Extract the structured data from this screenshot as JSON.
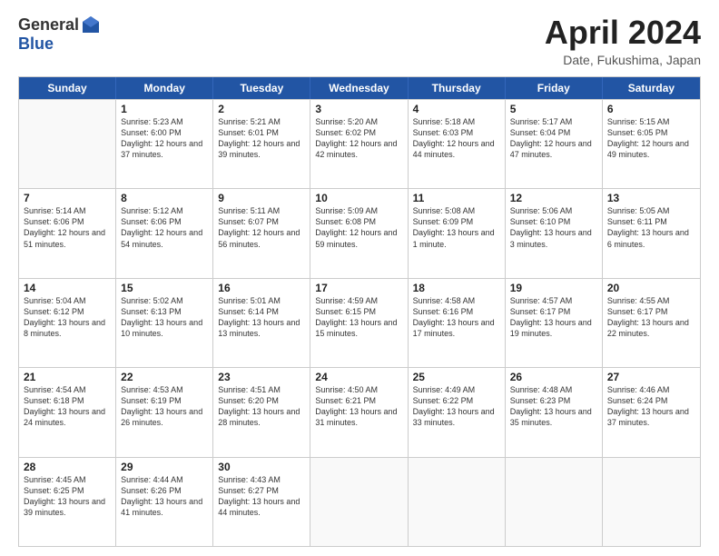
{
  "logo": {
    "general": "General",
    "blue": "Blue"
  },
  "header": {
    "month": "April 2024",
    "location": "Date, Fukushima, Japan"
  },
  "weekdays": [
    "Sunday",
    "Monday",
    "Tuesday",
    "Wednesday",
    "Thursday",
    "Friday",
    "Saturday"
  ],
  "weeks": [
    [
      {
        "day": "",
        "sunrise": "",
        "sunset": "",
        "daylight": ""
      },
      {
        "day": "1",
        "sunrise": "Sunrise: 5:23 AM",
        "sunset": "Sunset: 6:00 PM",
        "daylight": "Daylight: 12 hours and 37 minutes."
      },
      {
        "day": "2",
        "sunrise": "Sunrise: 5:21 AM",
        "sunset": "Sunset: 6:01 PM",
        "daylight": "Daylight: 12 hours and 39 minutes."
      },
      {
        "day": "3",
        "sunrise": "Sunrise: 5:20 AM",
        "sunset": "Sunset: 6:02 PM",
        "daylight": "Daylight: 12 hours and 42 minutes."
      },
      {
        "day": "4",
        "sunrise": "Sunrise: 5:18 AM",
        "sunset": "Sunset: 6:03 PM",
        "daylight": "Daylight: 12 hours and 44 minutes."
      },
      {
        "day": "5",
        "sunrise": "Sunrise: 5:17 AM",
        "sunset": "Sunset: 6:04 PM",
        "daylight": "Daylight: 12 hours and 47 minutes."
      },
      {
        "day": "6",
        "sunrise": "Sunrise: 5:15 AM",
        "sunset": "Sunset: 6:05 PM",
        "daylight": "Daylight: 12 hours and 49 minutes."
      }
    ],
    [
      {
        "day": "7",
        "sunrise": "Sunrise: 5:14 AM",
        "sunset": "Sunset: 6:06 PM",
        "daylight": "Daylight: 12 hours and 51 minutes."
      },
      {
        "day": "8",
        "sunrise": "Sunrise: 5:12 AM",
        "sunset": "Sunset: 6:06 PM",
        "daylight": "Daylight: 12 hours and 54 minutes."
      },
      {
        "day": "9",
        "sunrise": "Sunrise: 5:11 AM",
        "sunset": "Sunset: 6:07 PM",
        "daylight": "Daylight: 12 hours and 56 minutes."
      },
      {
        "day": "10",
        "sunrise": "Sunrise: 5:09 AM",
        "sunset": "Sunset: 6:08 PM",
        "daylight": "Daylight: 12 hours and 59 minutes."
      },
      {
        "day": "11",
        "sunrise": "Sunrise: 5:08 AM",
        "sunset": "Sunset: 6:09 PM",
        "daylight": "Daylight: 13 hours and 1 minute."
      },
      {
        "day": "12",
        "sunrise": "Sunrise: 5:06 AM",
        "sunset": "Sunset: 6:10 PM",
        "daylight": "Daylight: 13 hours and 3 minutes."
      },
      {
        "day": "13",
        "sunrise": "Sunrise: 5:05 AM",
        "sunset": "Sunset: 6:11 PM",
        "daylight": "Daylight: 13 hours and 6 minutes."
      }
    ],
    [
      {
        "day": "14",
        "sunrise": "Sunrise: 5:04 AM",
        "sunset": "Sunset: 6:12 PM",
        "daylight": "Daylight: 13 hours and 8 minutes."
      },
      {
        "day": "15",
        "sunrise": "Sunrise: 5:02 AM",
        "sunset": "Sunset: 6:13 PM",
        "daylight": "Daylight: 13 hours and 10 minutes."
      },
      {
        "day": "16",
        "sunrise": "Sunrise: 5:01 AM",
        "sunset": "Sunset: 6:14 PM",
        "daylight": "Daylight: 13 hours and 13 minutes."
      },
      {
        "day": "17",
        "sunrise": "Sunrise: 4:59 AM",
        "sunset": "Sunset: 6:15 PM",
        "daylight": "Daylight: 13 hours and 15 minutes."
      },
      {
        "day": "18",
        "sunrise": "Sunrise: 4:58 AM",
        "sunset": "Sunset: 6:16 PM",
        "daylight": "Daylight: 13 hours and 17 minutes."
      },
      {
        "day": "19",
        "sunrise": "Sunrise: 4:57 AM",
        "sunset": "Sunset: 6:17 PM",
        "daylight": "Daylight: 13 hours and 19 minutes."
      },
      {
        "day": "20",
        "sunrise": "Sunrise: 4:55 AM",
        "sunset": "Sunset: 6:17 PM",
        "daylight": "Daylight: 13 hours and 22 minutes."
      }
    ],
    [
      {
        "day": "21",
        "sunrise": "Sunrise: 4:54 AM",
        "sunset": "Sunset: 6:18 PM",
        "daylight": "Daylight: 13 hours and 24 minutes."
      },
      {
        "day": "22",
        "sunrise": "Sunrise: 4:53 AM",
        "sunset": "Sunset: 6:19 PM",
        "daylight": "Daylight: 13 hours and 26 minutes."
      },
      {
        "day": "23",
        "sunrise": "Sunrise: 4:51 AM",
        "sunset": "Sunset: 6:20 PM",
        "daylight": "Daylight: 13 hours and 28 minutes."
      },
      {
        "day": "24",
        "sunrise": "Sunrise: 4:50 AM",
        "sunset": "Sunset: 6:21 PM",
        "daylight": "Daylight: 13 hours and 31 minutes."
      },
      {
        "day": "25",
        "sunrise": "Sunrise: 4:49 AM",
        "sunset": "Sunset: 6:22 PM",
        "daylight": "Daylight: 13 hours and 33 minutes."
      },
      {
        "day": "26",
        "sunrise": "Sunrise: 4:48 AM",
        "sunset": "Sunset: 6:23 PM",
        "daylight": "Daylight: 13 hours and 35 minutes."
      },
      {
        "day": "27",
        "sunrise": "Sunrise: 4:46 AM",
        "sunset": "Sunset: 6:24 PM",
        "daylight": "Daylight: 13 hours and 37 minutes."
      }
    ],
    [
      {
        "day": "28",
        "sunrise": "Sunrise: 4:45 AM",
        "sunset": "Sunset: 6:25 PM",
        "daylight": "Daylight: 13 hours and 39 minutes."
      },
      {
        "day": "29",
        "sunrise": "Sunrise: 4:44 AM",
        "sunset": "Sunset: 6:26 PM",
        "daylight": "Daylight: 13 hours and 41 minutes."
      },
      {
        "day": "30",
        "sunrise": "Sunrise: 4:43 AM",
        "sunset": "Sunset: 6:27 PM",
        "daylight": "Daylight: 13 hours and 44 minutes."
      },
      {
        "day": "",
        "sunrise": "",
        "sunset": "",
        "daylight": ""
      },
      {
        "day": "",
        "sunrise": "",
        "sunset": "",
        "daylight": ""
      },
      {
        "day": "",
        "sunrise": "",
        "sunset": "",
        "daylight": ""
      },
      {
        "day": "",
        "sunrise": "",
        "sunset": "",
        "daylight": ""
      }
    ]
  ]
}
